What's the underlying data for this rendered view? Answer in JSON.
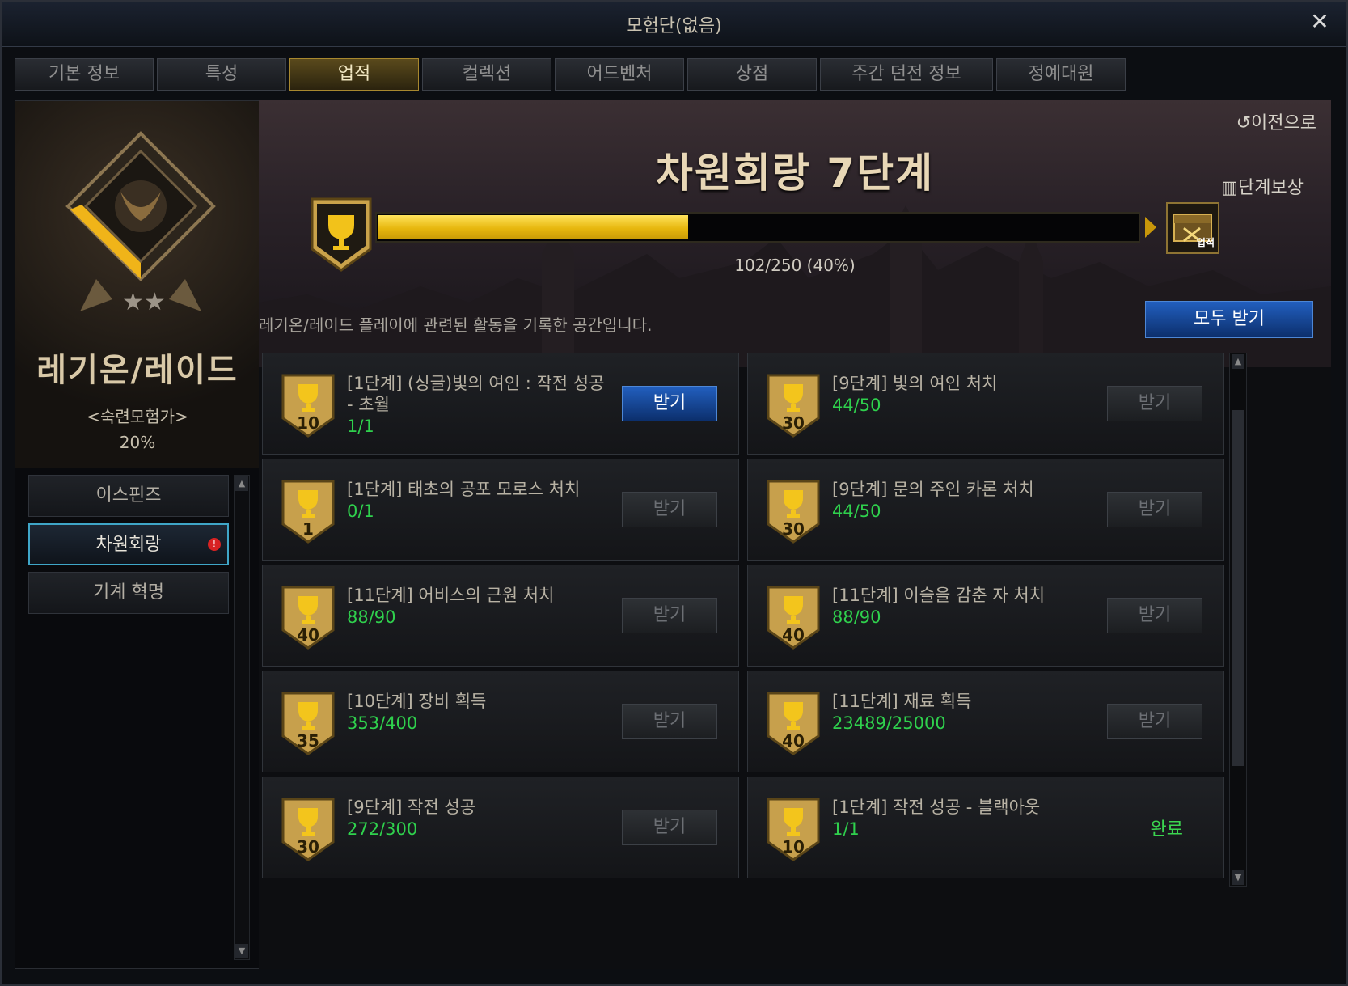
{
  "window": {
    "title": "모험단(없음)"
  },
  "tabs": [
    {
      "label": "기본 정보",
      "active": false
    },
    {
      "label": "특성",
      "active": false
    },
    {
      "label": "업적",
      "active": true
    },
    {
      "label": "컬렉션",
      "active": false
    },
    {
      "label": "어드벤처",
      "active": false
    },
    {
      "label": "상점",
      "active": false
    },
    {
      "label": "주간 던전 정보",
      "active": false
    },
    {
      "label": "정예대원",
      "active": false
    }
  ],
  "sidebar": {
    "category_title": "레기온/레이드",
    "rank": "<숙련모험가>",
    "percent": "20%",
    "items": [
      {
        "label": "이스핀즈",
        "active": false,
        "alert": false
      },
      {
        "label": "차원회랑",
        "active": true,
        "alert": true
      },
      {
        "label": "기계 혁명",
        "active": false,
        "alert": false
      }
    ]
  },
  "header": {
    "back_label": "이전으로",
    "stage_title": "차원회랑 7단계",
    "reward_label": "단계보상",
    "reward_chest_label": "업적",
    "progress_text": "102/250 (40%)",
    "progress_fraction": 0.408,
    "description": "레기온/레이드 플레이에 관련된 활동을 기록한 공간입니다.",
    "receive_all_label": "모두 받기"
  },
  "achievements": [
    {
      "points": "10",
      "title": "[1단계] (싱글)빛의 여인 : 작전 성공 - 초월",
      "progress": "1/1",
      "button": "받기",
      "state": "active"
    },
    {
      "points": "30",
      "title": "[9단계] 빛의 여인 처치",
      "progress": "44/50",
      "button": "받기",
      "state": "disabled"
    },
    {
      "points": "1",
      "title": "[1단계] 태초의 공포 모로스 처치",
      "progress": "0/1",
      "button": "받기",
      "state": "disabled"
    },
    {
      "points": "30",
      "title": "[9단계] 문의 주인 카론 처치",
      "progress": "44/50",
      "button": "받기",
      "state": "disabled"
    },
    {
      "points": "40",
      "title": "[11단계] 어비스의 근원 처치",
      "progress": "88/90",
      "button": "받기",
      "state": "disabled"
    },
    {
      "points": "40",
      "title": "[11단계] 이슬을 감춘 자 처치",
      "progress": "88/90",
      "button": "받기",
      "state": "disabled"
    },
    {
      "points": "35",
      "title": "[10단계] 장비 획득",
      "progress": "353/400",
      "button": "받기",
      "state": "disabled"
    },
    {
      "points": "40",
      "title": "[11단계] 재료 획득",
      "progress": "23489/25000",
      "button": "받기",
      "state": "disabled"
    },
    {
      "points": "30",
      "title": "[9단계] 작전 성공",
      "progress": "272/300",
      "button": "받기",
      "state": "disabled"
    },
    {
      "points": "10",
      "title": "[1단계] 작전 성공 - 블랙아웃",
      "progress": "1/1",
      "button": "완료",
      "state": "done"
    }
  ],
  "colors": {
    "accent_gold": "#e7b70e",
    "button_blue": "#225fbf",
    "progress_green": "#2fd14d",
    "alert_red": "#d82222"
  }
}
